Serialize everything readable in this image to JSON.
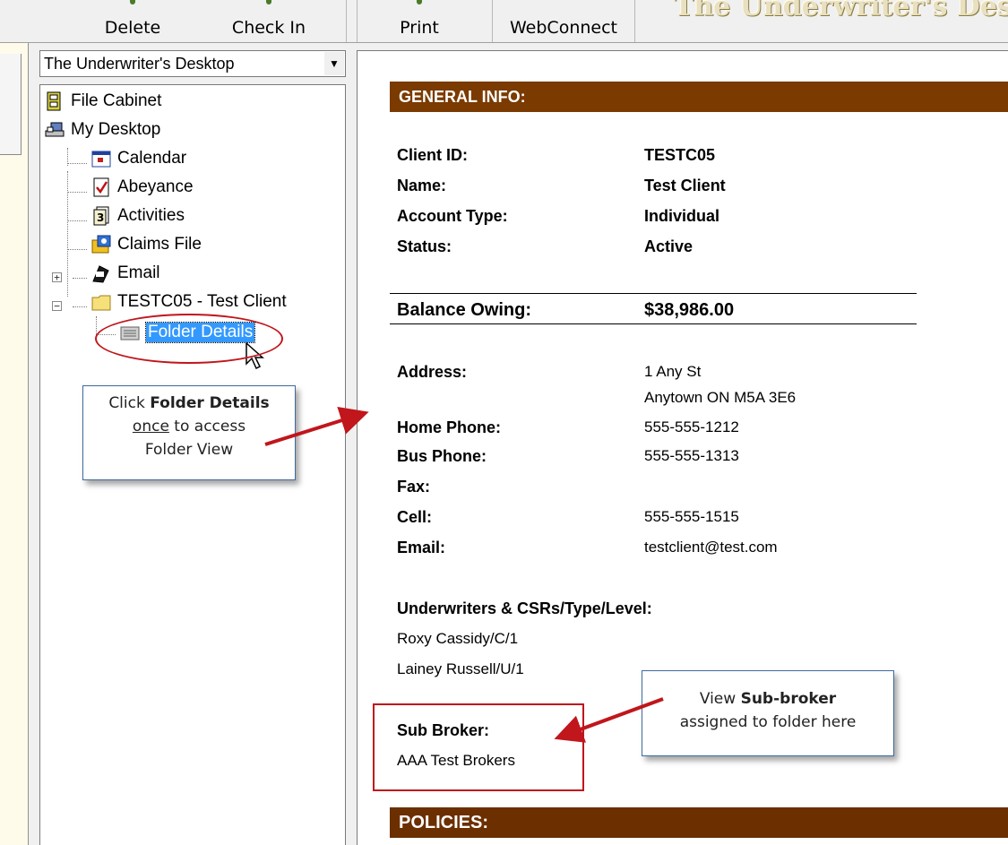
{
  "toolbar": {
    "delete_label": "Delete",
    "checkin_label": "Check In",
    "print_label": "Print",
    "webconnect_label": "WebConnect",
    "app_title": "The Underwriter's Desktop"
  },
  "tree": {
    "selector_value": "The Underwriter's Desktop",
    "items": [
      {
        "label": "File Cabinet",
        "icon": "file-cabinet-icon"
      },
      {
        "label": "My Desktop",
        "icon": "desktop-icon"
      },
      {
        "label": "Calendar",
        "icon": "calendar-icon"
      },
      {
        "label": "Abeyance",
        "icon": "checklist-icon"
      },
      {
        "label": "Activities",
        "icon": "activities-icon"
      },
      {
        "label": "Claims File",
        "icon": "claims-icon"
      },
      {
        "label": "Email",
        "icon": "email-icon"
      },
      {
        "label": "TESTC05 - Test Client",
        "icon": "folder-icon"
      },
      {
        "label": "Folder Details",
        "icon": "folder-details-icon"
      }
    ]
  },
  "detail": {
    "general_header": "GENERAL INFO:",
    "client_id_label": "Client ID:",
    "client_id": "TESTC05",
    "name_label": "Name:",
    "name": "Test Client",
    "account_type_label": "Account Type:",
    "account_type": "Individual",
    "status_label": "Status:",
    "status": "Active",
    "balance_label": "Balance Owing:",
    "balance": "$38,986.00",
    "address_label": "Address:",
    "address_line1": "1 Any St",
    "address_line2": "Anytown ON  M5A 3E6",
    "home_phone_label": "Home Phone:",
    "home_phone": "555-555-1212",
    "bus_phone_label": "Bus Phone:",
    "bus_phone": "555-555-1313",
    "fax_label": "Fax:",
    "cell_label": "Cell:",
    "cell": "555-555-1515",
    "email_label": "Email:",
    "email": "testclient@test.com",
    "underwriters_label": "Underwriters & CSRs/Type/Level:",
    "underwriters": [
      "Roxy Cassidy/C/1",
      "Lainey Russell/U/1"
    ],
    "sub_broker_label": "Sub Broker:",
    "sub_broker": "AAA Test Brokers",
    "policies_header": "POLICIES:"
  },
  "annotations": {
    "callout1": {
      "pre": "Click ",
      "bold": "Folder Details",
      "underline": "once",
      "post": " to access",
      "line3": "Folder View"
    },
    "callout2": {
      "line1_pre": "View ",
      "line1_bold": "Sub-broker",
      "line2": "assigned to folder here"
    },
    "accent_color": "#c0161c"
  }
}
